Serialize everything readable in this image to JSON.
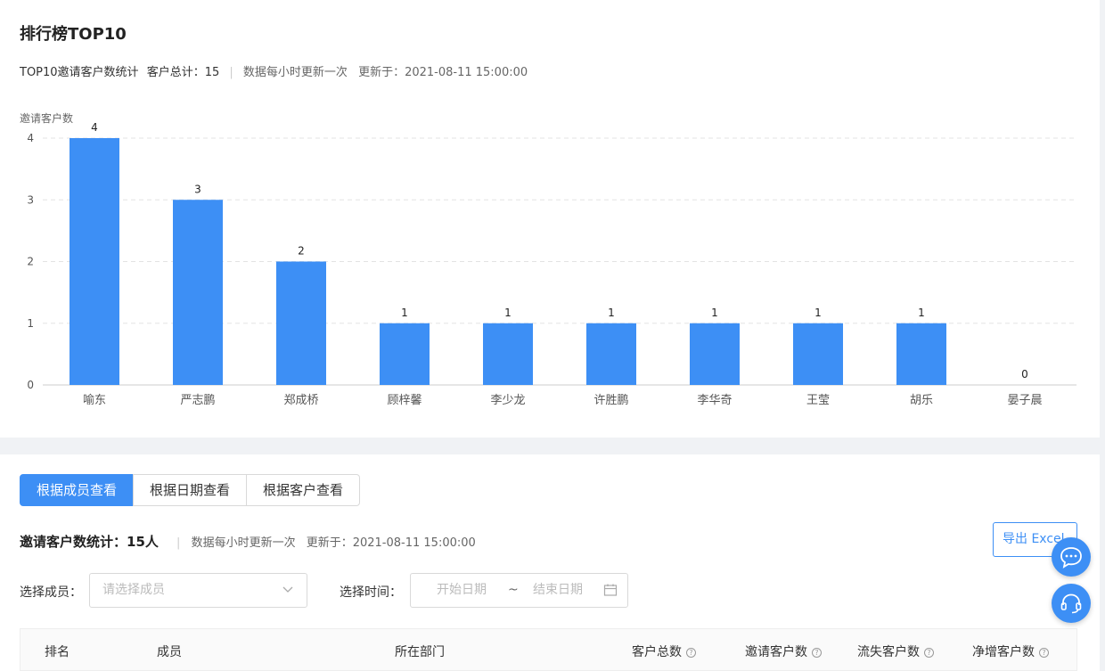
{
  "ranking": {
    "title": "排行榜TOP10",
    "stat_label": "TOP10邀请客户数统计",
    "total_label": "客户总计：15",
    "update_note": "数据每小时更新一次",
    "updated_at": "更新于：2021-08-11 15:00:00"
  },
  "chart_data": {
    "type": "bar",
    "ylabel": "邀请客户数",
    "xlabel": "",
    "title": "",
    "categories": [
      "喻东",
      "严志鹏",
      "郑成桥",
      "顾梓馨",
      "李少龙",
      "许胜鹏",
      "李华奇",
      "王莹",
      "胡乐",
      "晏子晨"
    ],
    "values": [
      4,
      3,
      2,
      1,
      1,
      1,
      1,
      1,
      1,
      0
    ],
    "yticks": [
      0,
      1,
      2,
      3,
      4
    ],
    "ylim": [
      0,
      4
    ],
    "grid": true,
    "bar_color": "#3d8ff5"
  },
  "tabs": [
    {
      "label": "根据成员查看",
      "active": true
    },
    {
      "label": "根据日期查看",
      "active": false
    },
    {
      "label": "根据客户查看",
      "active": false
    }
  ],
  "stats": {
    "label": "邀请客户数统计：",
    "count": "15人",
    "update_note": "数据每小时更新一次",
    "updated_at": "更新于：2021-08-11 15:00:00"
  },
  "export_label": "导出 Excel",
  "filters": {
    "member_label": "选择成员：",
    "member_placeholder": "请选择成员",
    "time_label": "选择时间：",
    "start_placeholder": "开始日期",
    "range_sep": "~",
    "end_placeholder": "结束日期"
  },
  "table": {
    "columns": [
      "排名",
      "成员",
      "所在部门",
      "客户总数",
      "邀请客户数",
      "流失客户数",
      "净增客户数"
    ]
  },
  "colors": {
    "accent": "#3d8ff5"
  },
  "icons": {
    "chat": "chat-bubble-icon",
    "support": "headset-icon",
    "calendar": "calendar-icon",
    "help": "question-circle-icon"
  }
}
